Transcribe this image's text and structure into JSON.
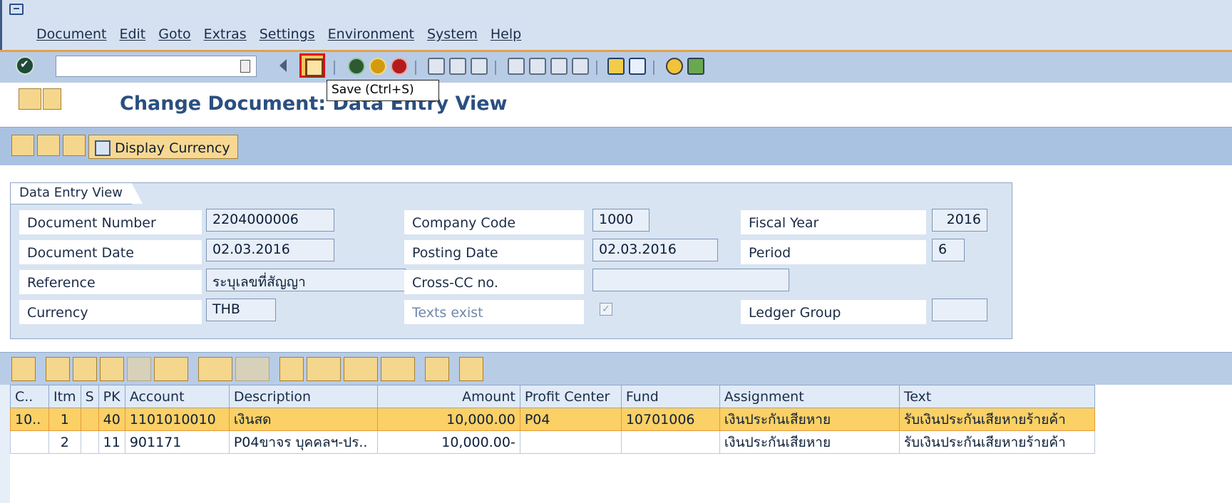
{
  "menu": {
    "items": [
      "Document",
      "Edit",
      "Goto",
      "Extras",
      "Settings",
      "Environment",
      "System",
      "Help"
    ]
  },
  "toolbar": {
    "command_value": "",
    "save_tooltip": "Save   (Ctrl+S)"
  },
  "title": {
    "text": "Change Document: Data Entry View"
  },
  "app_toolbar": {
    "display_currency_label": "Display Currency"
  },
  "header": {
    "tab_label": "Data Entry View",
    "document_number_label": "Document Number",
    "document_number": "2204000006",
    "company_code_label": "Company Code",
    "company_code": "1000",
    "fiscal_year_label": "Fiscal Year",
    "fiscal_year": "2016",
    "document_date_label": "Document Date",
    "document_date": "02.03.2016",
    "posting_date_label": "Posting Date",
    "posting_date": "02.03.2016",
    "period_label": "Period",
    "period": "6",
    "reference_label": "Reference",
    "reference": "ระบุเลขที่สัญญา",
    "cross_cc_label": "Cross-CC no.",
    "cross_cc": "",
    "currency_label": "Currency",
    "currency": "THB",
    "texts_exist_label": "Texts exist",
    "ledger_group_label": "Ledger Group",
    "ledger_group": ""
  },
  "table": {
    "columns": [
      "C..",
      "Itm",
      "S",
      "PK",
      "Account",
      "Description",
      "Amount",
      "Profit Center",
      "Fund",
      "Assignment",
      "Text"
    ],
    "rows": [
      {
        "c": "10..",
        "itm": "1",
        "s": "",
        "pk": "40",
        "account": "1101010010",
        "description": "เงินสด",
        "amount": "10,000.00",
        "profit_center": "P04",
        "fund": "10701006",
        "assignment": "เงินประกันเสียหาย",
        "text": "รับเงินประกันเสียหายร้ายค้า"
      },
      {
        "c": "",
        "itm": "2",
        "s": "",
        "pk": "11",
        "account": "901171",
        "description": "P04ขาจร บุคคลฯ-ปร..",
        "amount": "10,000.00-",
        "profit_center": "",
        "fund": "",
        "assignment": "เงินประกันเสียหาย",
        "text": "รับเงินประกันเสียหายร้ายค้า"
      }
    ]
  }
}
